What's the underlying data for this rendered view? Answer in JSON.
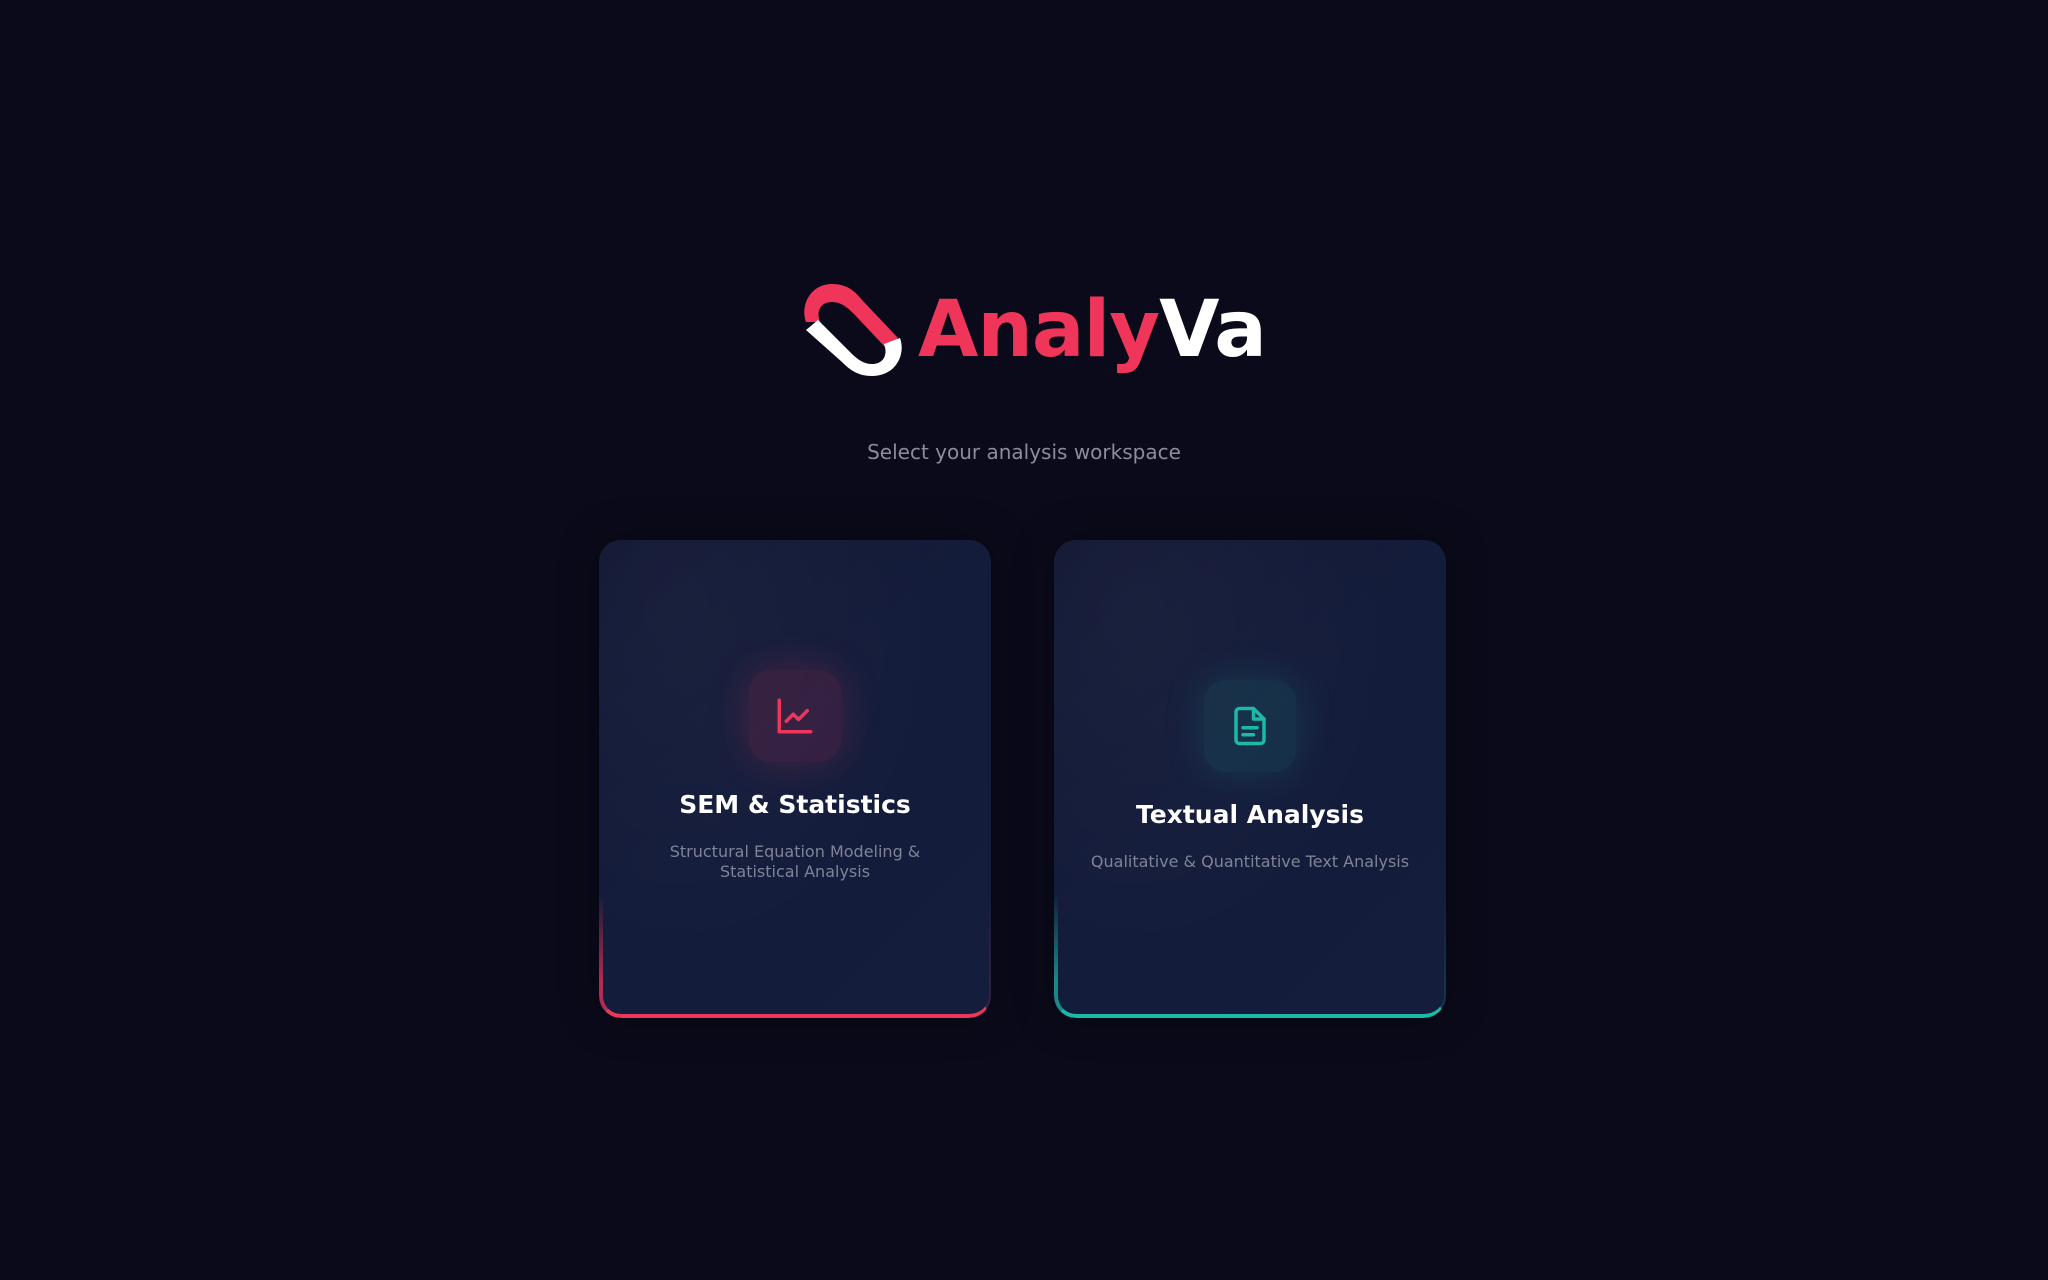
{
  "brand": {
    "name_part1": "Analy",
    "name_part2": "Va",
    "logo_icon": "analyva-logo-icon"
  },
  "subtitle": "Select your analysis workspace",
  "workspaces": [
    {
      "id": "sem",
      "title": "SEM & Statistics",
      "description": "Structural Equation Modeling & Statistical Analysis",
      "icon": "line-chart-icon",
      "accent_color": "#f0355a"
    },
    {
      "id": "text",
      "title": "Textual Analysis",
      "description": "Qualitative & Quantitative Text Analysis",
      "icon": "document-icon",
      "accent_color": "#1cb8a8"
    }
  ],
  "colors": {
    "background": "#0a0a1a",
    "brand_red": "#f0355a",
    "brand_white": "#ffffff",
    "card_bg": "#141c3b"
  }
}
